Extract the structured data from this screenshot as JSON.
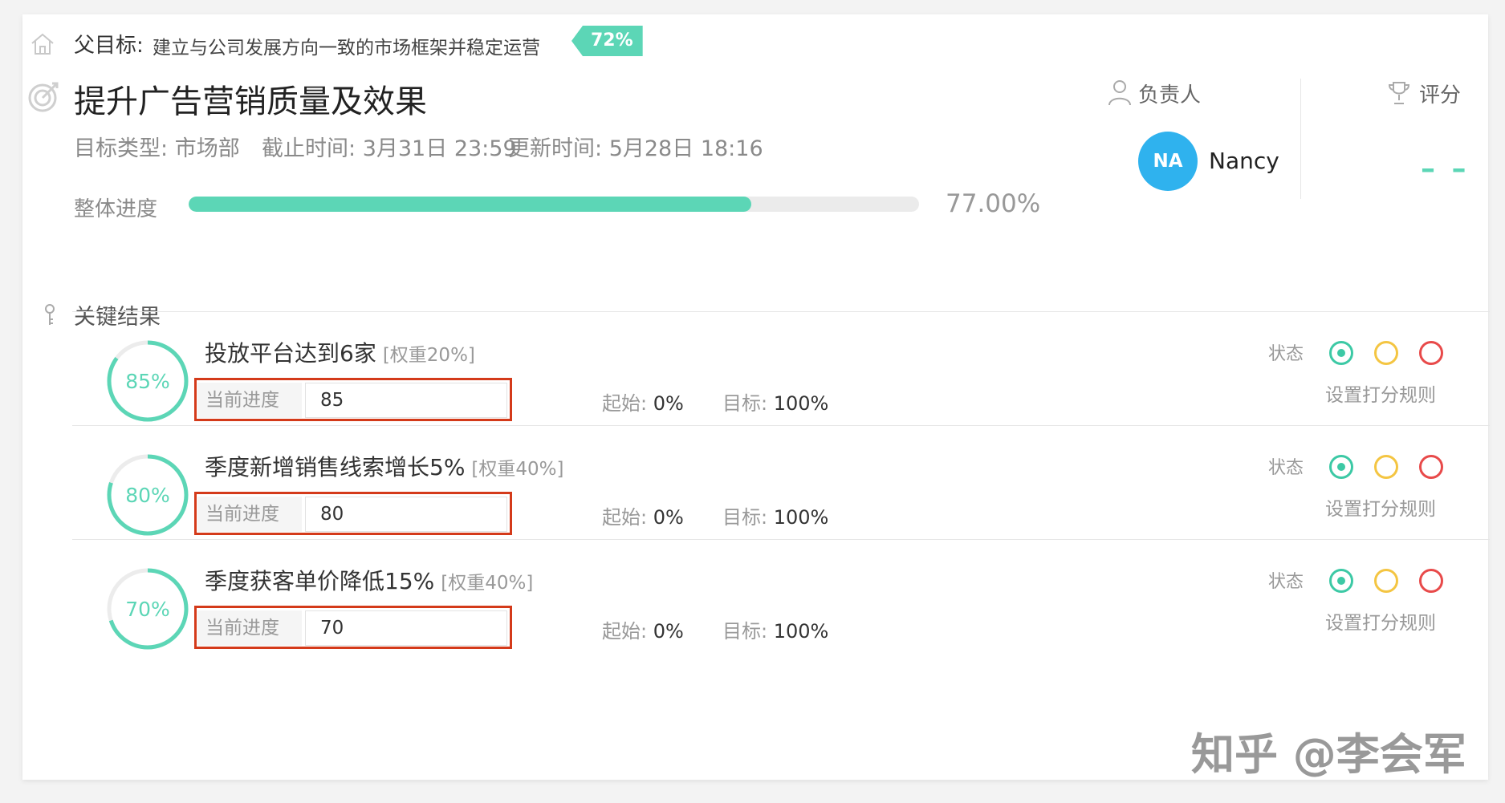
{
  "parent": {
    "label": "父目标:",
    "title": "建立与公司发展方向一致的市场框架并稳定运营",
    "badge": "72%"
  },
  "objective": {
    "title": "提升广告营销质量及效果",
    "type_label": "目标类型:",
    "type_value": "市场部",
    "deadline_label": "截止时间:",
    "deadline_value": "3月31日 23:59",
    "updated_label": "更新时间:",
    "updated_value": "5月28日 18:16",
    "progress_label": "整体进度",
    "progress_value": 0.77,
    "progress_text": "77.00%"
  },
  "owner": {
    "label": "负责人",
    "initials": "NA",
    "name": "Nancy",
    "avatar_color": "#2fb2ee"
  },
  "score": {
    "label": "评分",
    "value": "– –"
  },
  "key_results": {
    "heading": "关键结果",
    "items": [
      {
        "percent_text": "85%",
        "percent": 0.85,
        "title": "投放平台达到6家",
        "weight": "[权重20%]",
        "input_label": "当前进度",
        "input_value": "85",
        "start_label": "起始:",
        "start_value": "0%",
        "target_label": "目标:",
        "target_value": "100%",
        "status_label": "状态",
        "rules_label": "设置打分规则"
      },
      {
        "percent_text": "80%",
        "percent": 0.8,
        "title": "季度新增销售线索增长5%",
        "weight": "[权重40%]",
        "input_label": "当前进度",
        "input_value": "80",
        "start_label": "起始:",
        "start_value": "0%",
        "target_label": "目标:",
        "target_value": "100%",
        "status_label": "状态",
        "rules_label": "设置打分规则"
      },
      {
        "percent_text": "70%",
        "percent": 0.7,
        "title": "季度获客单价降低15%",
        "weight": "[权重40%]",
        "input_label": "当前进度",
        "input_value": "70",
        "start_label": "起始:",
        "start_value": "0%",
        "target_label": "目标:",
        "target_value": "100%",
        "status_label": "状态",
        "rules_label": "设置打分规则"
      }
    ]
  },
  "colors": {
    "accent": "#5cd6b6",
    "status_green": "#3cc9a5",
    "status_yellow": "#f4c542",
    "status_red": "#e84a4a",
    "highlight_box": "#d43a1a"
  },
  "icons": [
    "home-icon",
    "target-icon",
    "person-icon",
    "trophy-icon",
    "key-icon"
  ],
  "watermark": "知乎 @李会军"
}
